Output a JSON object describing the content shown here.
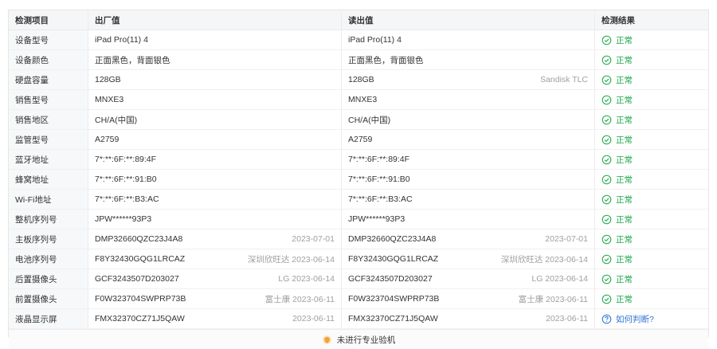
{
  "header": {
    "item": "检测项目",
    "factory": "出厂值",
    "read": "读出值",
    "result": "检测结果"
  },
  "rows": [
    {
      "item": "设备型号",
      "factory": "iPad Pro(11) 4",
      "factory_sub": "",
      "read": "iPad Pro(11) 4",
      "read_sub": "",
      "result": "正常",
      "status": "ok"
    },
    {
      "item": "设备颜色",
      "factory": "正面黑色，背面银色",
      "factory_sub": "",
      "read": "正面黑色，背面银色",
      "read_sub": "",
      "result": "正常",
      "status": "ok"
    },
    {
      "item": "硬盘容量",
      "factory": "128GB",
      "factory_sub": "",
      "read": "128GB",
      "read_sub": "Sandisk TLC",
      "result": "正常",
      "status": "ok"
    },
    {
      "item": "销售型号",
      "factory": "MNXE3",
      "factory_sub": "",
      "read": "MNXE3",
      "read_sub": "",
      "result": "正常",
      "status": "ok"
    },
    {
      "item": "销售地区",
      "factory": "CH/A(中国)",
      "factory_sub": "",
      "read": "CH/A(中国)",
      "read_sub": "",
      "result": "正常",
      "status": "ok"
    },
    {
      "item": "监管型号",
      "factory": "A2759",
      "factory_sub": "",
      "read": "A2759",
      "read_sub": "",
      "result": "正常",
      "status": "ok"
    },
    {
      "item": "蓝牙地址",
      "factory": "7*:**:6F:**:89:4F",
      "factory_sub": "",
      "read": "7*:**:6F:**:89:4F",
      "read_sub": "",
      "result": "正常",
      "status": "ok"
    },
    {
      "item": "蜂窝地址",
      "factory": "7*:**:6F:**:91:B0",
      "factory_sub": "",
      "read": "7*:**:6F:**:91:B0",
      "read_sub": "",
      "result": "正常",
      "status": "ok"
    },
    {
      "item": "Wi-Fi地址",
      "factory": "7*:**:6F:**:B3:AC",
      "factory_sub": "",
      "read": "7*:**:6F:**:B3:AC",
      "read_sub": "",
      "result": "正常",
      "status": "ok"
    },
    {
      "item": "整机序列号",
      "factory": "JPW******93P3",
      "factory_sub": "",
      "read": "JPW******93P3",
      "read_sub": "",
      "result": "正常",
      "status": "ok"
    },
    {
      "item": "主板序列号",
      "factory": "DMP32660QZC23J4A8",
      "factory_sub": "2023-07-01",
      "read": "DMP32660QZC23J4A8",
      "read_sub": "2023-07-01",
      "result": "正常",
      "status": "ok"
    },
    {
      "item": "电池序列号",
      "factory": "F8Y32430GQG1LRCAZ",
      "factory_sub": "深圳欣旺达 2023-06-14",
      "read": "F8Y32430GQG1LRCAZ",
      "read_sub": "深圳欣旺达 2023-06-14",
      "result": "正常",
      "status": "ok"
    },
    {
      "item": "后置摄像头",
      "factory": "GCF3243507D203027",
      "factory_sub": "LG 2023-06-14",
      "read": "GCF3243507D203027",
      "read_sub": "LG 2023-06-14",
      "result": "正常",
      "status": "ok"
    },
    {
      "item": "前置摄像头",
      "factory": "F0W323704SWPRP73B",
      "factory_sub": "富士康 2023-06-11",
      "read": "F0W323704SWPRP73B",
      "read_sub": "富士康 2023-06-11",
      "result": "正常",
      "status": "ok"
    },
    {
      "item": "液晶显示屏",
      "factory": "FMX32370CZ71J5QAW",
      "factory_sub": "2023-06-11",
      "read": "FMX32370CZ71J5QAW",
      "read_sub": "2023-06-11",
      "result": "如何判断?",
      "status": "question"
    }
  ],
  "footer": {
    "text": "未进行专业验机",
    "icon": "shield-icon"
  },
  "colors": {
    "ok": "#1ea84a",
    "question": "#2f74d6",
    "header_bg": "#f5f6f8"
  }
}
